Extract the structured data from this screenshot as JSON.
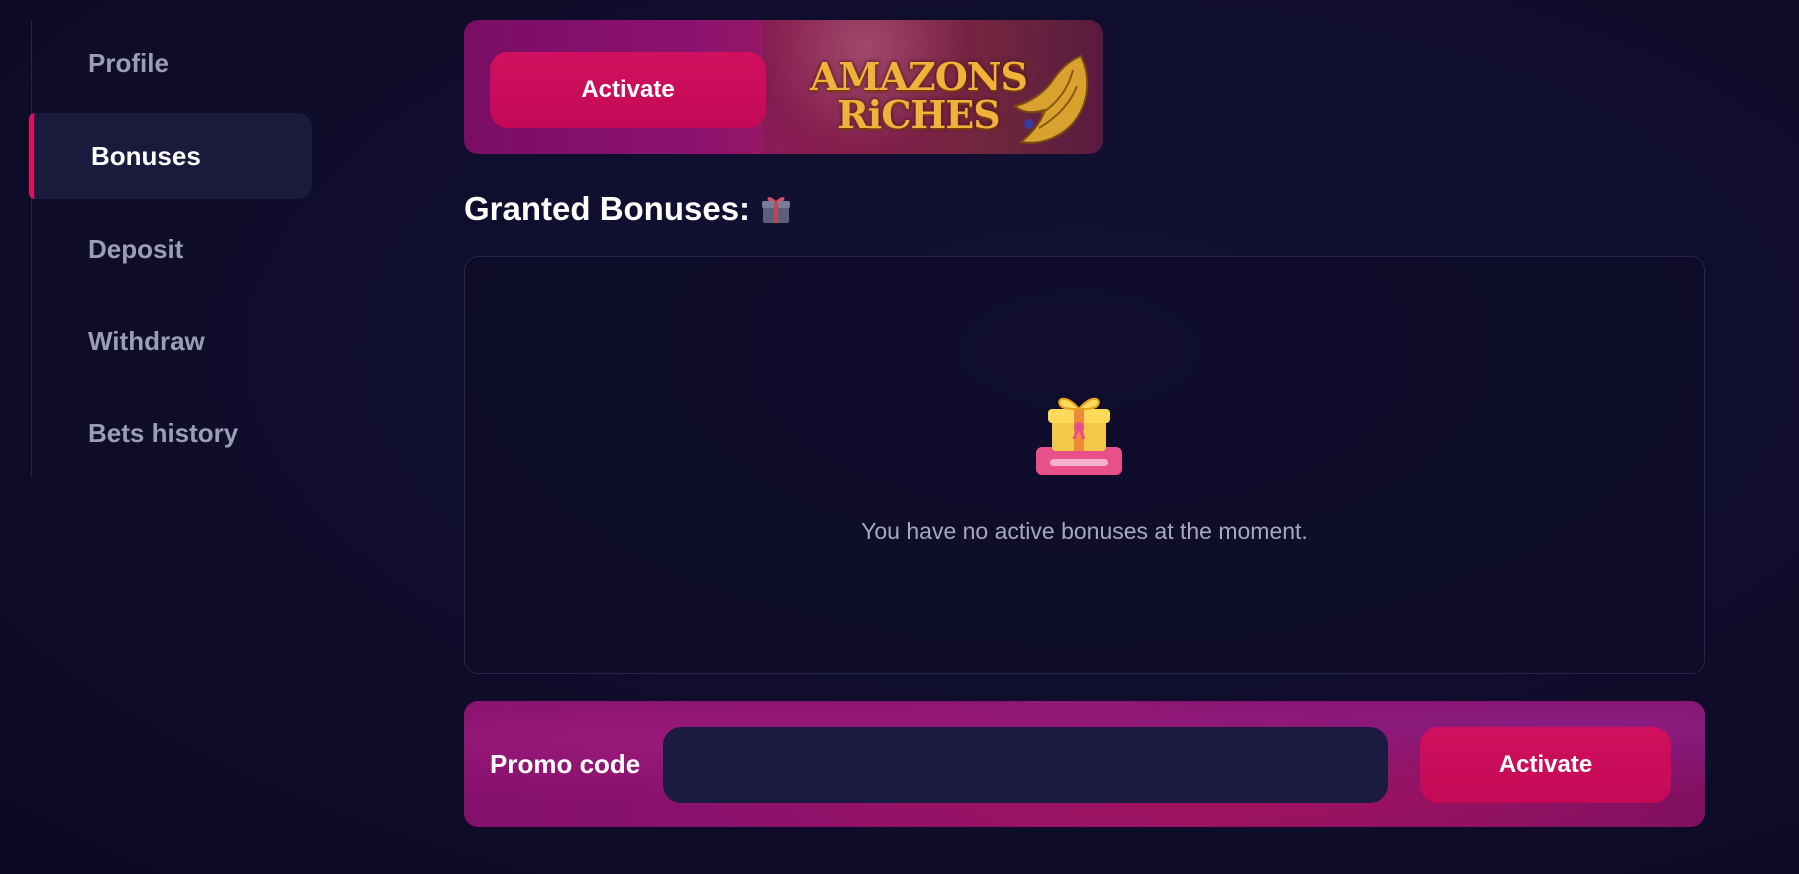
{
  "sidebar": {
    "items": [
      {
        "label": "Profile",
        "active": false
      },
      {
        "label": "Bonuses",
        "active": true
      },
      {
        "label": "Deposit",
        "active": false
      },
      {
        "label": "Withdraw",
        "active": false
      },
      {
        "label": "Bets history",
        "active": false
      }
    ]
  },
  "banner": {
    "activate_label": "Activate",
    "game_title_line1": "AMAZONS",
    "game_title_line2": "RiCHES"
  },
  "granted": {
    "title": "Granted Bonuses:",
    "icon": "gift-icon",
    "empty_icon": "gift-box-icon",
    "empty_message": "You have no active bonuses at the moment."
  },
  "promo": {
    "label": "Promo code",
    "value": "",
    "placeholder": "",
    "activate_label": "Activate"
  },
  "colors": {
    "background": "#0f0d2a",
    "accent": "#c30a56",
    "sidebar_active": "#1a1a3d",
    "input_bg": "#1b1b42"
  }
}
